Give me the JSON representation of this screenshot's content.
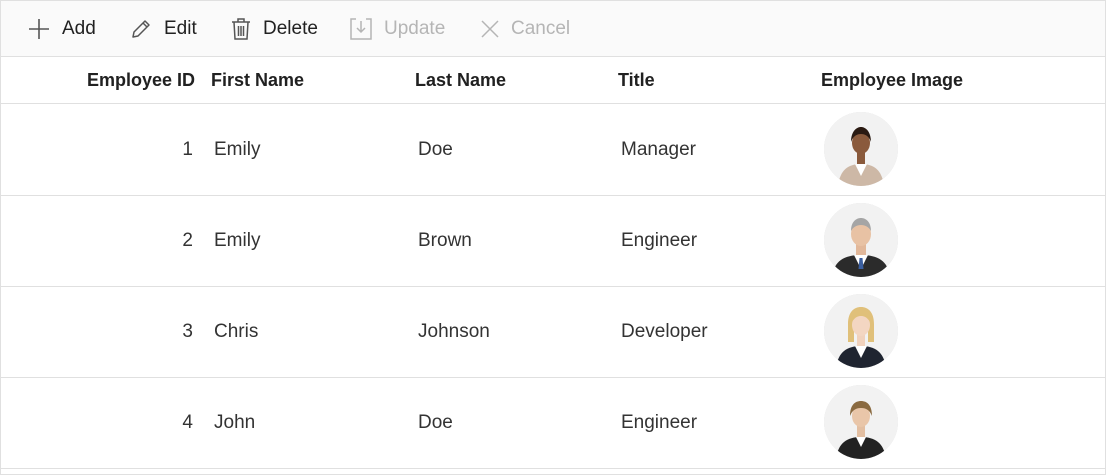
{
  "toolbar": {
    "add": "Add",
    "edit": "Edit",
    "delete": "Delete",
    "update": "Update",
    "cancel": "Cancel"
  },
  "columns": {
    "id": "Employee ID",
    "first": "First Name",
    "last": "Last Name",
    "title": "Title",
    "image": "Employee Image"
  },
  "rows": [
    {
      "id": "1",
      "first": "Emily",
      "last": "Doe",
      "title": "Manager",
      "image": "avatar-woman-beige-blazer"
    },
    {
      "id": "2",
      "first": "Emily",
      "last": "Brown",
      "title": "Engineer",
      "image": "avatar-man-gray-hair-suit"
    },
    {
      "id": "3",
      "first": "Chris",
      "last": "Johnson",
      "title": "Developer",
      "image": "avatar-woman-blonde-dark-blazer"
    },
    {
      "id": "4",
      "first": "John",
      "last": "Doe",
      "title": "Engineer",
      "image": "avatar-woman-short-hair-dark-jacket"
    }
  ]
}
